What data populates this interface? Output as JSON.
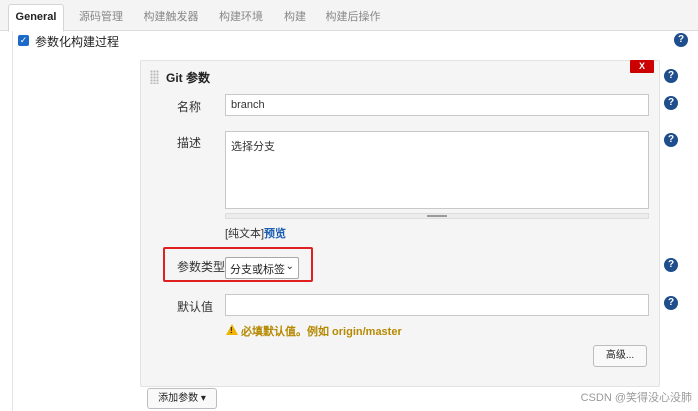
{
  "tabs": [
    {
      "label": "General",
      "active": true
    },
    {
      "label": "源码管理",
      "active": false
    },
    {
      "label": "构建触发器",
      "active": false
    },
    {
      "label": "构建环境",
      "active": false
    },
    {
      "label": "构建",
      "active": false
    },
    {
      "label": "构建后操作",
      "active": false
    }
  ],
  "parameterized": {
    "label": "参数化构建过程",
    "checked": true
  },
  "panel": {
    "title": "Git 参数",
    "delete_label": "X",
    "name_label": "名称",
    "name_value": "branch",
    "desc_label": "描述",
    "desc_value": "选择分支",
    "plain_text": "[纯文本]",
    "preview": "预览",
    "type_label": "参数类型",
    "type_value": "分支或标签",
    "default_label": "默认值",
    "default_value": "",
    "warning": "必填默认值。例如 origin/master",
    "advanced_label": "高级..."
  },
  "add_param_label": "添加参数 ▾",
  "help_glyph": "?",
  "watermark": "CSDN @笑得没心没肺",
  "colors": {
    "help": "#1f4e8c",
    "delete": "#cc0000",
    "highlight": "#e02020",
    "link": "#1a5fb4",
    "warning": "#b58900"
  },
  "icons": [
    "checkbox-checked-icon",
    "drag-grip-icon",
    "help-icon",
    "warning-icon",
    "chevron-down-icon"
  ]
}
